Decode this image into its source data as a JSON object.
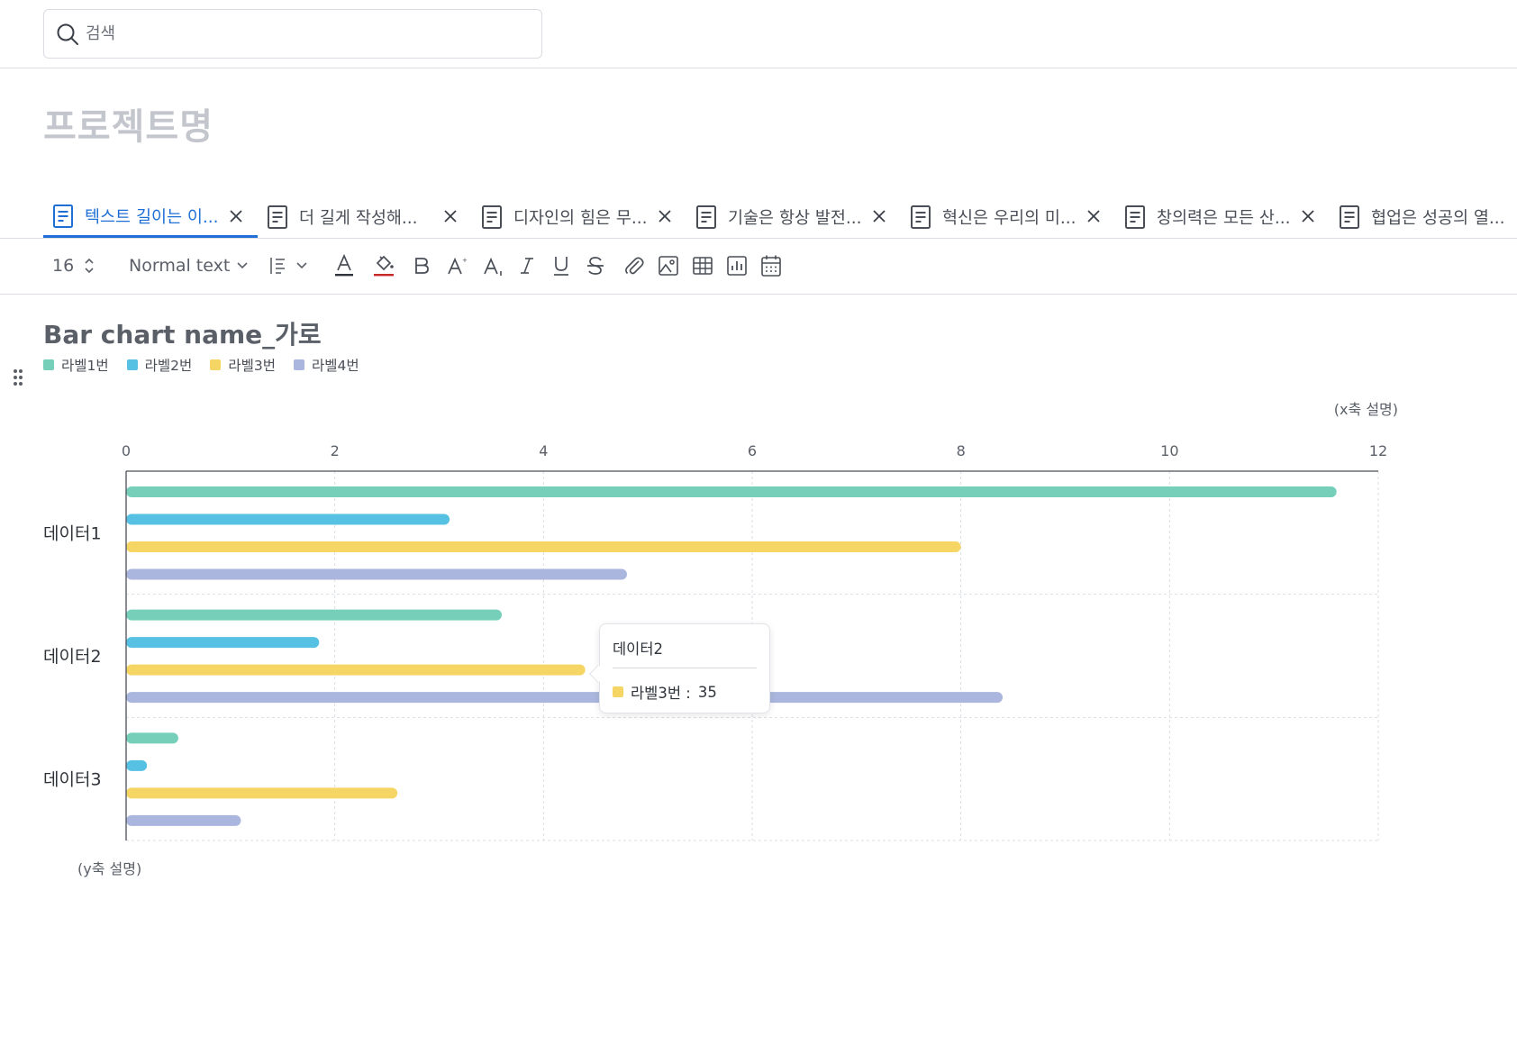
{
  "search": {
    "placeholder": "검색"
  },
  "project": {
    "title": "프로젝트명"
  },
  "tabs": [
    {
      "label": "텍스트 길이는 이...",
      "active": true
    },
    {
      "label": "더 길게 작성해..."
    },
    {
      "label": "디자인의 힘은 무..."
    },
    {
      "label": "기술은 항상 발전..."
    },
    {
      "label": "혁신은 우리의 미..."
    },
    {
      "label": "창의력은 모든 산..."
    },
    {
      "label": "협업은 성공의 열..."
    }
  ],
  "toolbar": {
    "font_size": "16",
    "text_style": "Normal text",
    "icons": [
      "line-spacing-icon",
      "font-color-icon",
      "highlight-icon",
      "bold-icon",
      "superscript-icon",
      "subscript-icon",
      "italic-icon",
      "underline-icon",
      "strikethrough-icon",
      "attach-icon",
      "image-icon",
      "table-icon",
      "chart-icon",
      "calendar-icon"
    ]
  },
  "colors": {
    "label1": "#76d0b9",
    "label2": "#56c1e2",
    "label3": "#f5d563",
    "label4": "#aab6dd",
    "accent": "#1f6fd6",
    "font_color_underline": "#2f343b",
    "highlight_underline": "#c62828"
  },
  "chart_data": {
    "type": "bar",
    "orientation": "horizontal",
    "title": "Bar chart name_가로",
    "xlabel": "(x축 설명)",
    "ylabel": "(y축 설명)",
    "categories": [
      "데이터1",
      "데이터2",
      "데이터3"
    ],
    "xlim": [
      0,
      12
    ],
    "xticks": [
      0,
      2,
      4,
      6,
      8,
      10,
      12
    ],
    "grid": true,
    "legend_position": "top-left",
    "series": [
      {
        "name": "라벨1번",
        "values": [
          11.6,
          3.6,
          0.5
        ]
      },
      {
        "name": "라벨2번",
        "values": [
          3.1,
          1.85,
          0.2
        ]
      },
      {
        "name": "라벨3번",
        "values": [
          8.0,
          4.4,
          2.6
        ]
      },
      {
        "name": "라벨4번",
        "values": [
          4.8,
          8.4,
          1.1
        ]
      }
    ],
    "tooltip": {
      "category": "데이터2",
      "series": "라벨3번",
      "label": "라벨3번 :",
      "value": "35"
    }
  }
}
